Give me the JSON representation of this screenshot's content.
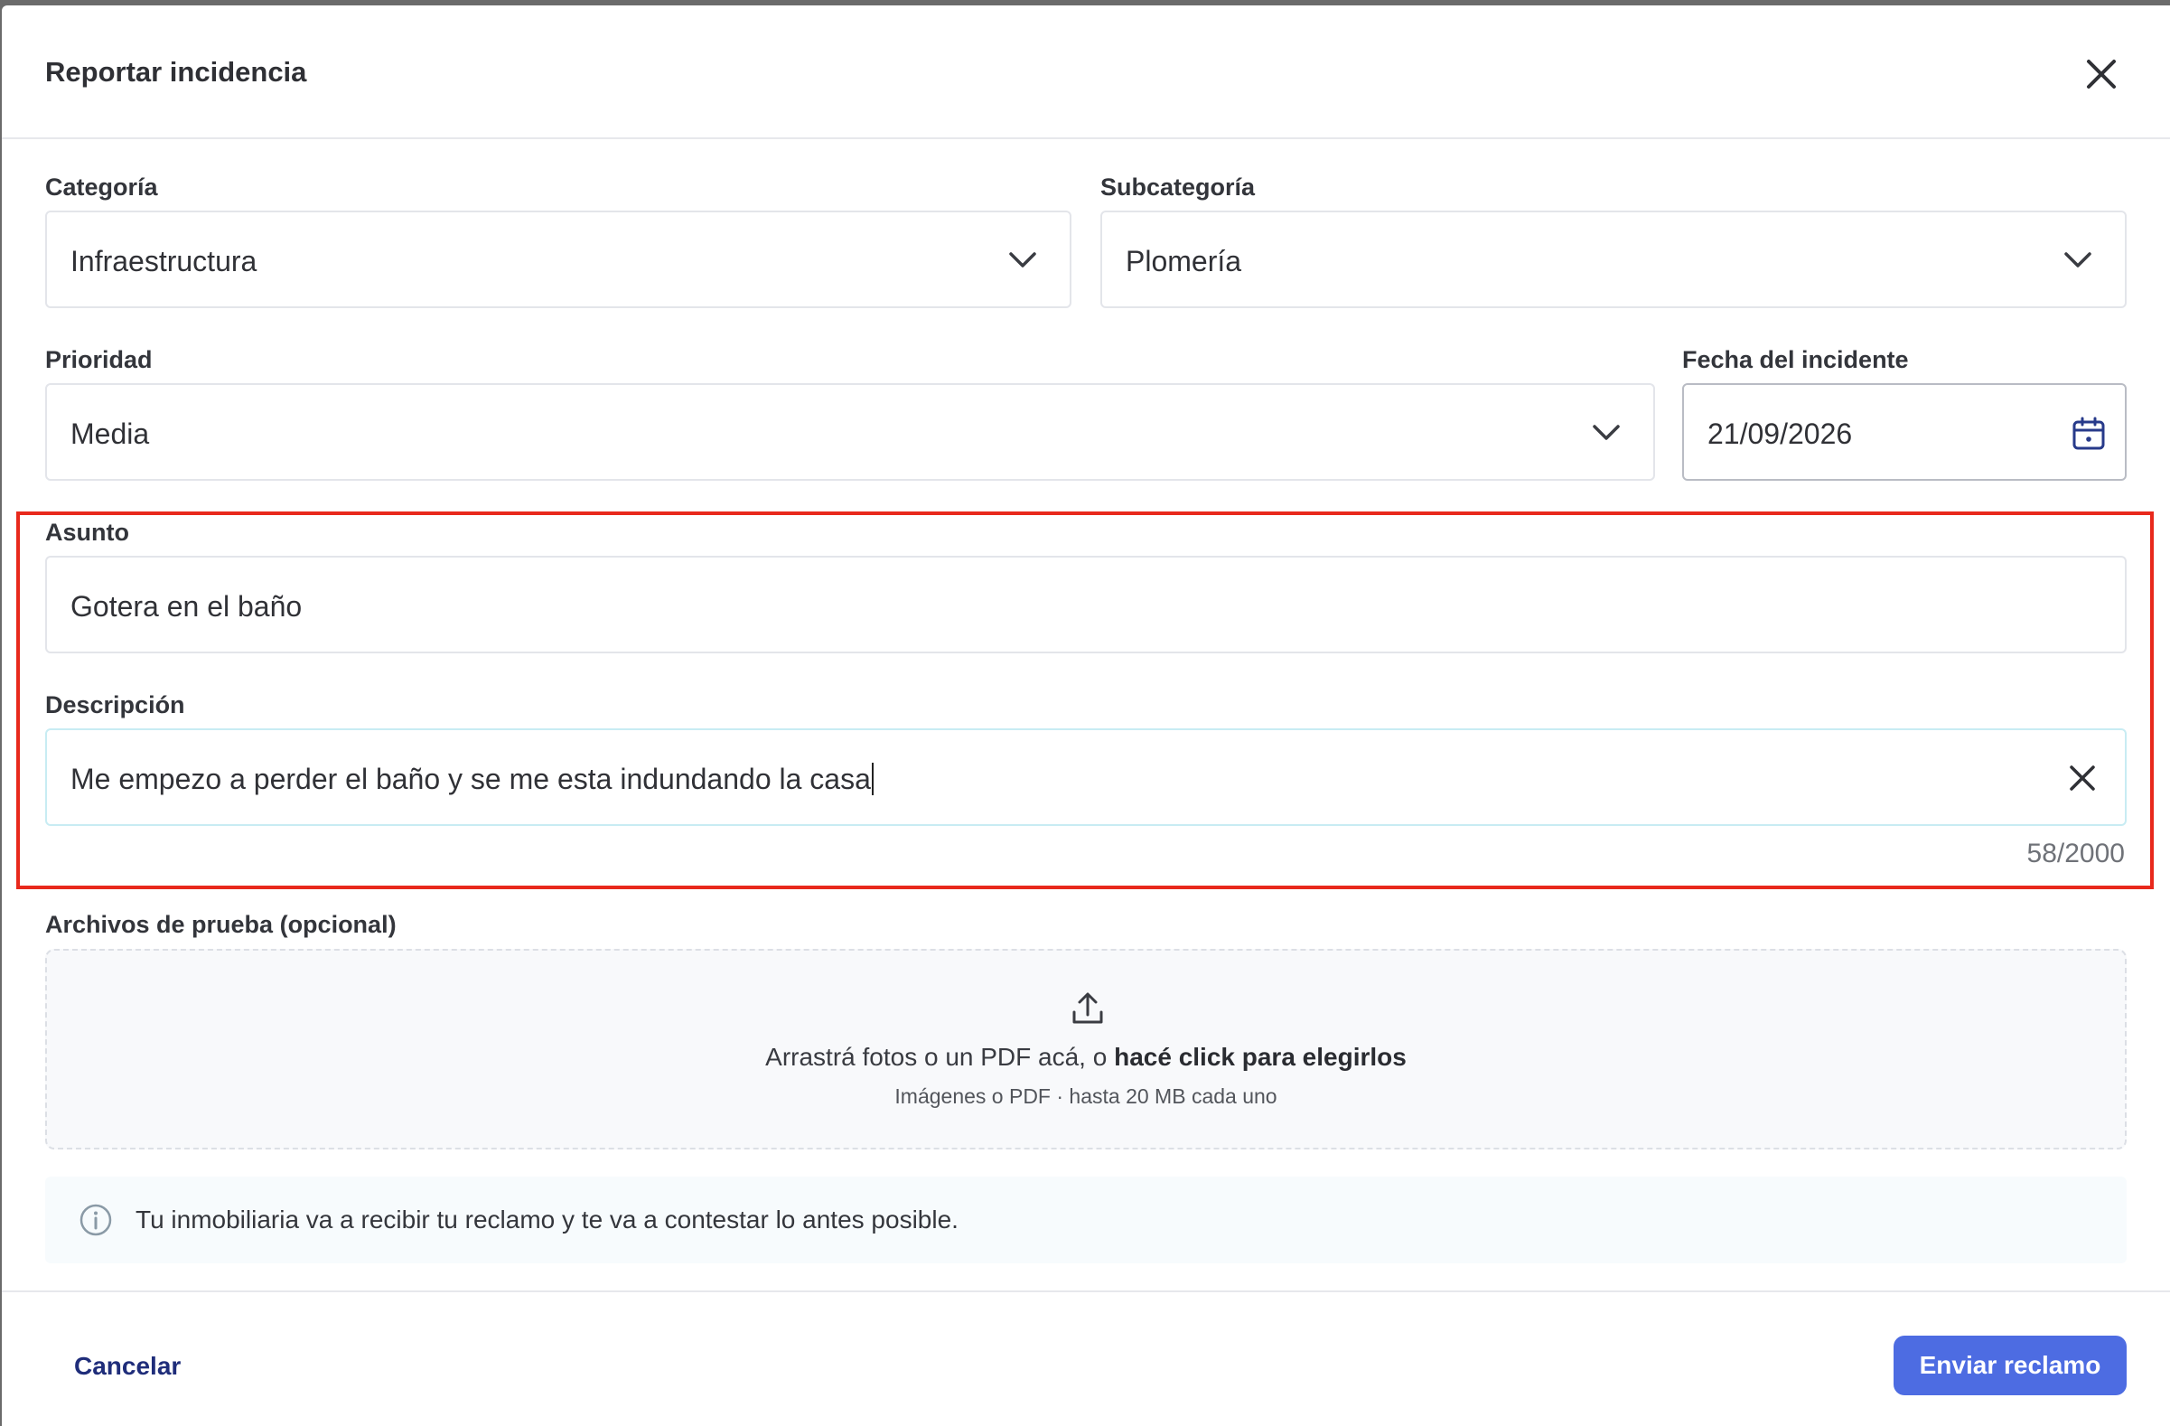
{
  "header": {
    "title": "Reportar incidencia"
  },
  "fields": {
    "categoria": {
      "label": "Categoría",
      "value": "Infraestructura"
    },
    "subcategoria": {
      "label": "Subcategoría",
      "value": "Plomería"
    },
    "prioridad": {
      "label": "Prioridad",
      "value": "Media"
    },
    "fecha": {
      "label": "Fecha del incidente",
      "value": "21/09/2026"
    },
    "asunto": {
      "label": "Asunto",
      "value": "Gotera en el baño"
    },
    "descripcion": {
      "label": "Descripción",
      "value": "Me empezo a perder el baño y se me esta indundando la casa",
      "counter": "58/2000"
    }
  },
  "attachments": {
    "label": "Archivos de prueba (opcional)",
    "prompt_text": "Arrastrá fotos o un PDF acá, o ",
    "prompt_link": "hacé click para elegirlos",
    "hint": "Imágenes o PDF · hasta 20 MB cada uno"
  },
  "info": {
    "text": "Tu inmobiliaria va a recibir tu reclamo y te va a contestar lo antes posible."
  },
  "footer": {
    "cancel_label": "Cancelar",
    "submit_label": "Enviar reclamo"
  },
  "colors": {
    "accent": "#4d6ce2",
    "cancel": "#1f2d7a",
    "highlight": "#e8291c"
  },
  "icons": {
    "close": "close-icon",
    "chevron": "chevron-down-icon",
    "calendar": "calendar-icon",
    "upload": "upload-icon",
    "info": "info-icon",
    "clear": "clear-icon"
  }
}
